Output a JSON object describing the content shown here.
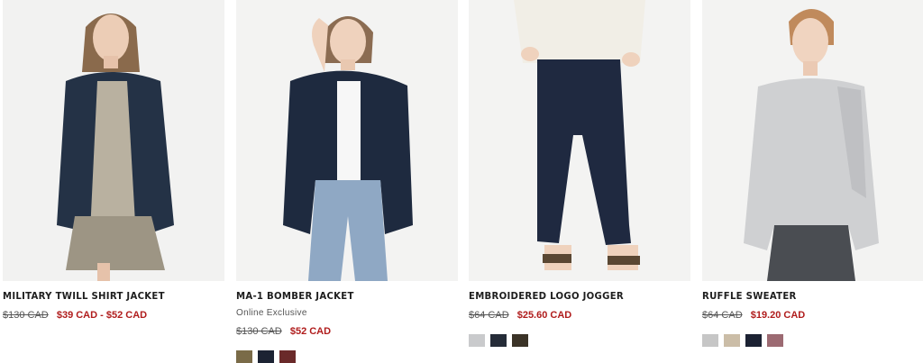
{
  "products": [
    {
      "name": "MILITARY TWILL SHIRT JACKET",
      "original_price": "$130 CAD",
      "sale_price": "$39 CAD - $52 CAD",
      "swatches": []
    },
    {
      "name": "MA-1 BOMBER JACKET",
      "badge": "Online Exclusive",
      "original_price": "$130 CAD",
      "sale_price": "$52 CAD",
      "swatches": [
        "#7a6b48",
        "#1c2333",
        "#6a2a2a"
      ]
    },
    {
      "name": "EMBROIDERED LOGO JOGGER",
      "original_price": "$64 CAD",
      "sale_price": "$25.60 CAD",
      "swatches": [
        "#c9cacc",
        "#252c38",
        "#3b3327"
      ]
    },
    {
      "name": "RUFFLE SWEATER",
      "original_price": "$64 CAD",
      "sale_price": "$19.20 CAD",
      "swatches": [
        "#c6c6c6",
        "#cbbda7",
        "#1c2233",
        "#9c6a72"
      ]
    }
  ],
  "colors": {
    "sale": "#b01c1c",
    "text": "#1e1e1e"
  }
}
